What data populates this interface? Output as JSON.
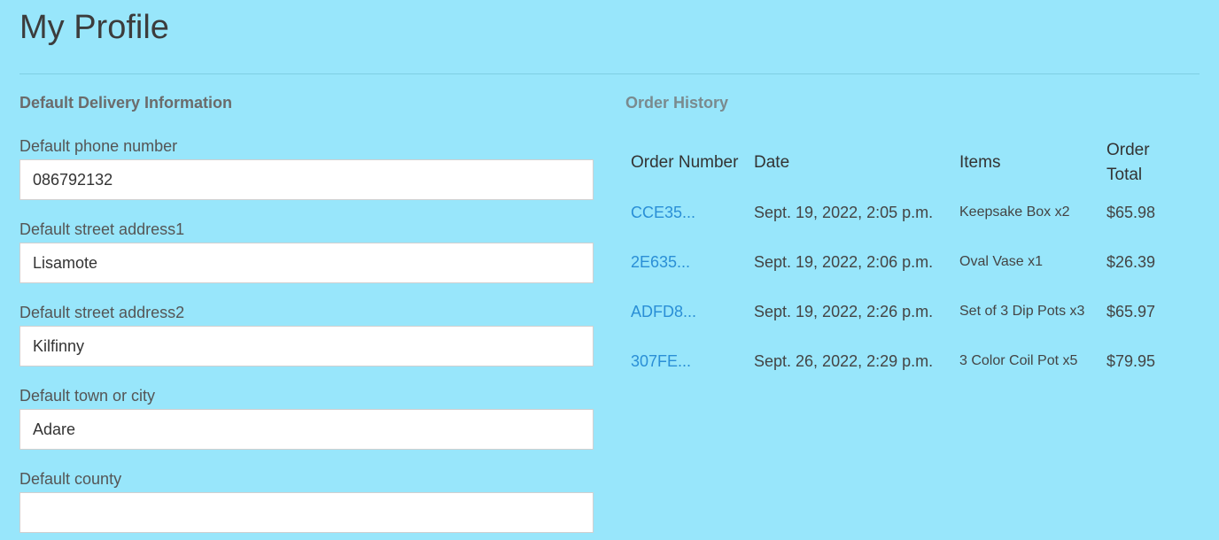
{
  "page": {
    "title": "My Profile"
  },
  "delivery": {
    "heading": "Default Delivery Information",
    "fields": [
      {
        "label": "Default phone number",
        "value": "086792132"
      },
      {
        "label": "Default street address1",
        "value": "Lisamote"
      },
      {
        "label": "Default street address2",
        "value": "Kilfinny"
      },
      {
        "label": "Default town or city",
        "value": "Adare"
      },
      {
        "label": "Default county",
        "value": ""
      }
    ]
  },
  "orders": {
    "heading": "Order History",
    "columns": [
      "Order Number",
      "Date",
      "Items",
      "Order Total"
    ],
    "rows": [
      {
        "number": "CCE35...",
        "date": "Sept. 19, 2022, 2:05 p.m.",
        "items": "Keepsake Box x2",
        "total": "$65.98"
      },
      {
        "number": "2E635...",
        "date": "Sept. 19, 2022, 2:06 p.m.",
        "items": "Oval Vase x1",
        "total": "$26.39"
      },
      {
        "number": "ADFD8...",
        "date": "Sept. 19, 2022, 2:26 p.m.",
        "items": "Set of 3 Dip Pots x3",
        "total": "$65.97"
      },
      {
        "number": "307FE...",
        "date": "Sept. 26, 2022, 2:29 p.m.",
        "items": "3 Color Coil Pot x5",
        "total": "$79.95"
      }
    ]
  },
  "colors": {
    "background": "#98e6fb",
    "link": "#2a8fd6"
  }
}
